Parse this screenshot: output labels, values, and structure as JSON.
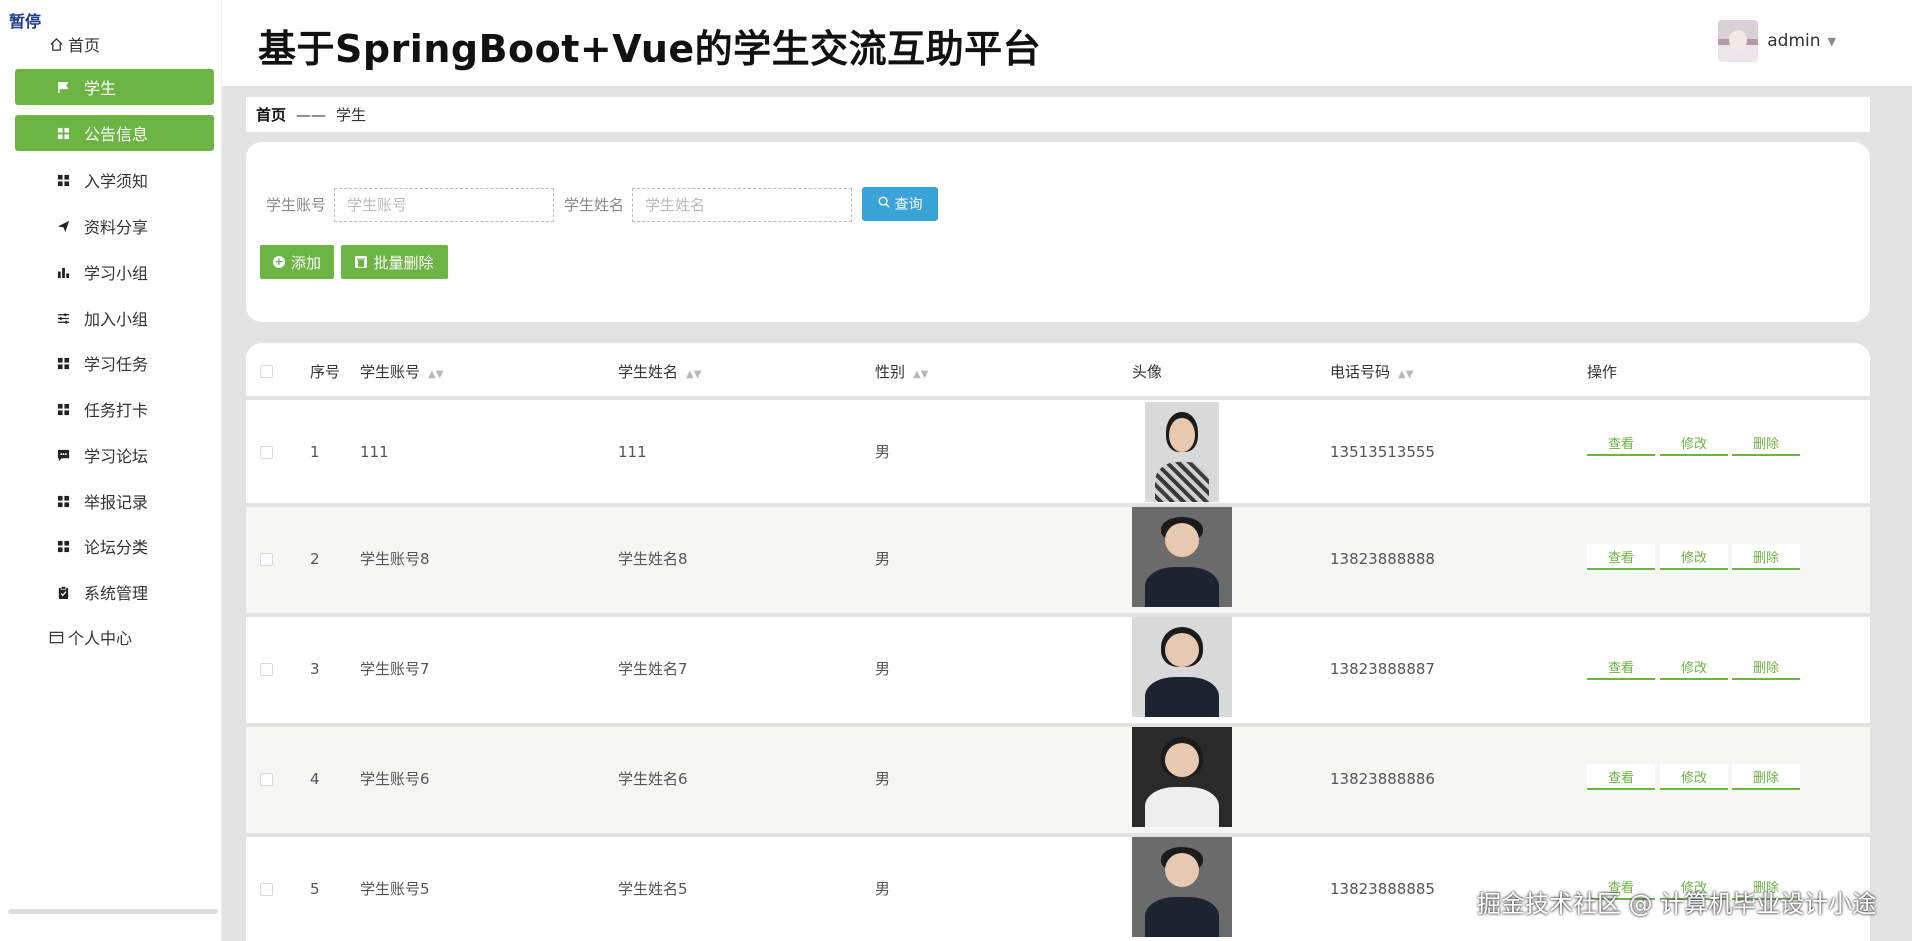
{
  "overlay": {
    "paused_label": "暂停",
    "watermark": "掘金技术社区 @ 计算机毕业设计小途"
  },
  "sidebar": {
    "home_label": "首页",
    "personal_label": "个人中心",
    "items": [
      {
        "label": "学生",
        "icon": "flag-icon",
        "active": true
      },
      {
        "label": "公告信息",
        "icon": "grid-icon",
        "active": true
      },
      {
        "label": "入学须知",
        "icon": "grid-icon",
        "active": false
      },
      {
        "label": "资料分享",
        "icon": "paper-plane-icon",
        "active": false
      },
      {
        "label": "学习小组",
        "icon": "bar-chart-icon",
        "active": false
      },
      {
        "label": "加入小组",
        "icon": "sliders-icon",
        "active": false
      },
      {
        "label": "学习任务",
        "icon": "grid-icon",
        "active": false
      },
      {
        "label": "任务打卡",
        "icon": "grid-icon",
        "active": false
      },
      {
        "label": "学习论坛",
        "icon": "chat-icon",
        "active": false
      },
      {
        "label": "举报记录",
        "icon": "grid-icon",
        "active": false
      },
      {
        "label": "论坛分类",
        "icon": "grid-icon",
        "active": false
      },
      {
        "label": "系统管理",
        "icon": "clipboard-icon",
        "active": false
      }
    ]
  },
  "header": {
    "title": "基于SpringBoot+Vue的学生交流互助平台",
    "username": "admin"
  },
  "breadcrumb": {
    "home": "首页",
    "separator": "——",
    "current": "学生"
  },
  "search": {
    "account_label": "学生账号",
    "account_placeholder": "学生账号",
    "name_label": "学生姓名",
    "name_placeholder": "学生姓名",
    "query_label": "查询",
    "add_label": "添加",
    "batch_delete_label": "批量删除"
  },
  "table": {
    "columns": {
      "index": "序号",
      "account": "学生账号",
      "name": "学生姓名",
      "gender": "性别",
      "avatar": "头像",
      "phone": "电话号码",
      "actions": "操作"
    },
    "action_labels": {
      "view": "查看",
      "edit": "修改",
      "delete": "删除"
    },
    "rows": [
      {
        "index": "1",
        "account": "111",
        "name": "111",
        "gender": "男",
        "phone": "13513513555"
      },
      {
        "index": "2",
        "account": "学生账号8",
        "name": "学生姓名8",
        "gender": "男",
        "phone": "13823888888"
      },
      {
        "index": "3",
        "account": "学生账号7",
        "name": "学生姓名7",
        "gender": "男",
        "phone": "13823888887"
      },
      {
        "index": "4",
        "account": "学生账号6",
        "name": "学生姓名6",
        "gender": "男",
        "phone": "13823888886"
      },
      {
        "index": "5",
        "account": "学生账号5",
        "name": "学生姓名5",
        "gender": "男",
        "phone": "13823888885"
      }
    ]
  },
  "colors": {
    "accent_green": "#6cb444",
    "query_blue": "#3aa3d8",
    "content_bg": "#e3e3e3"
  }
}
